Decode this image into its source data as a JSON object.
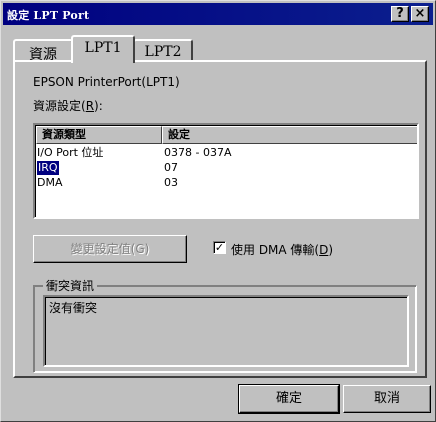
{
  "window": {
    "title": "設定 LPT Port",
    "help_button": "?",
    "close_button": "×"
  },
  "tabs": [
    {
      "label": "資源",
      "active": false
    },
    {
      "label": "LPT1",
      "active": true
    },
    {
      "label": "LPT2",
      "active": false
    }
  ],
  "panel": {
    "device_name": "EPSON PrinterPort(LPT1)",
    "resource_settings_label": "資源設定(",
    "resource_settings_key": "R",
    "resource_settings_suffix": "):",
    "list": {
      "columns": [
        "資源類型",
        "設定"
      ],
      "rows": [
        {
          "type": "I/O Port 位址",
          "value": "0378 - 037A",
          "selected": false
        },
        {
          "type": "IRQ",
          "value": "07",
          "selected": true
        },
        {
          "type": "DMA",
          "value": "03",
          "selected": false
        }
      ]
    },
    "change_settings_button": "變更設定值(G)",
    "change_settings_enabled": false,
    "dma_checkbox": {
      "checked": true,
      "mark": "✓",
      "label_prefix": "使用 DMA 傳輸(",
      "label_key": "D",
      "label_suffix": ")"
    },
    "conflict_group": {
      "caption": "衝突資訊",
      "text": "沒有衝突"
    }
  },
  "footer": {
    "ok_label": "確定",
    "cancel_label": "取消"
  },
  "colors": {
    "dialog_face": "#c0c0c0",
    "titlebar": "#000080",
    "selection": "#000080"
  }
}
